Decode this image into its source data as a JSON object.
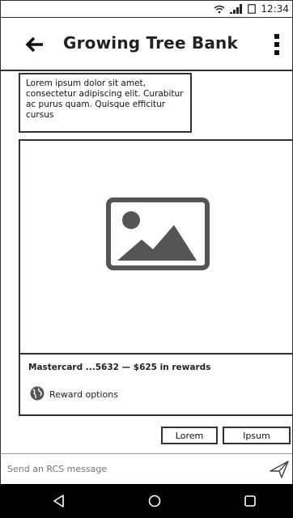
{
  "status_bar": {
    "time": "12:34",
    "icons": [
      "wifi-icon",
      "signal-icon",
      "battery-icon"
    ]
  },
  "app_bar": {
    "title": "Growing Tree Bank",
    "back_icon": "back-arrow-icon",
    "menu_icon": "overflow-menu-icon"
  },
  "message": {
    "text": "Lorem ipsum dolor sit amet, consectetur adipiscing elit. Curabitur ac purus quam. Quisque efficitur cursus"
  },
  "rich_card": {
    "media_icon": "image-placeholder-icon",
    "headline": "Mastercard ...5632 — $625 in rewards",
    "action": {
      "label": "Reward options",
      "icon": "globe-icon"
    }
  },
  "suggestions": [
    {
      "label": "Lorem"
    },
    {
      "label": "Ipsum"
    }
  ],
  "composer": {
    "placeholder": "Send an RCS message",
    "send_icon": "send-icon"
  },
  "nav_bar": {
    "icons": [
      "back-triangle-icon",
      "home-circle-icon",
      "recents-square-icon"
    ]
  },
  "colors": {
    "outline": "#333333",
    "nav_background": "#000000",
    "image_fill": "#555555"
  }
}
